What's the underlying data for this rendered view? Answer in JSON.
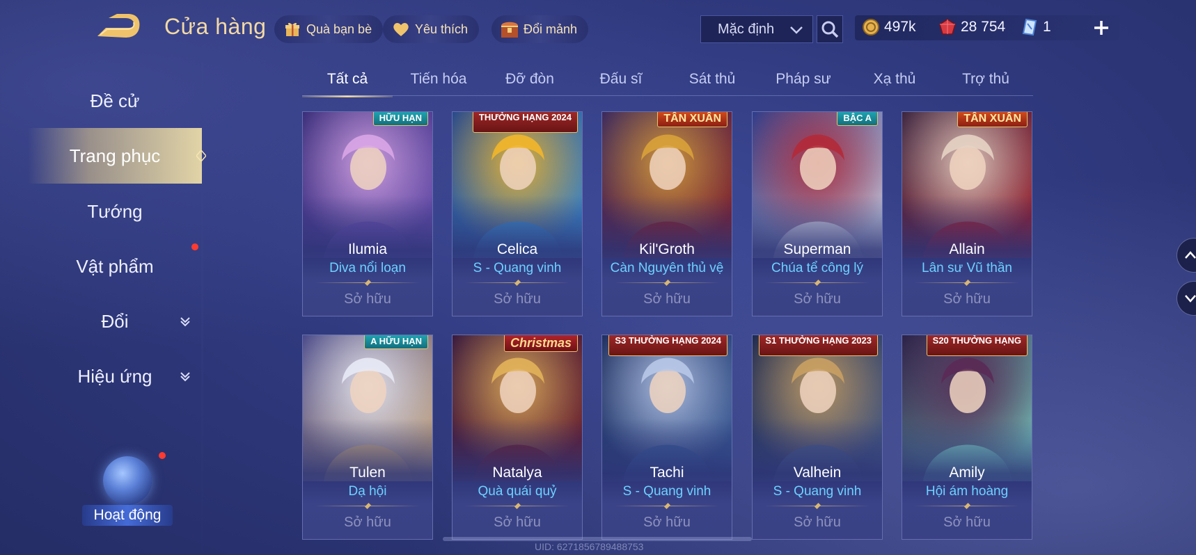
{
  "header": {
    "title": "Cửa hàng",
    "pills": [
      {
        "label": "Quà bạn bè",
        "icon": "gift-icon"
      },
      {
        "label": "Yêu thích",
        "icon": "heart-icon"
      },
      {
        "label": "Đổi mảnh",
        "icon": "chest-icon"
      }
    ],
    "sort_select": "Mặc định",
    "currencies": [
      {
        "value": "497k",
        "icon": "gold-coin-icon"
      },
      {
        "value": "28 754",
        "icon": "ruby-gem-icon"
      },
      {
        "value": "1",
        "icon": "blue-card-icon"
      }
    ]
  },
  "sidebar": {
    "items": [
      {
        "label": "Đề cử"
      },
      {
        "label": "Trang phục",
        "active": true
      },
      {
        "label": "Tướng"
      },
      {
        "label": "Vật phẩm"
      },
      {
        "label": "Đổi"
      },
      {
        "label": "Hiệu ứng"
      }
    ],
    "activity_label": "Hoạt động"
  },
  "tabs": [
    "Tất cả",
    "Tiến hóa",
    "Đỡ đòn",
    "Đấu sĩ",
    "Sát thủ",
    "Pháp sư",
    "Xạ thủ",
    "Trợ thủ"
  ],
  "active_tab": "Tất cả",
  "cards": [
    {
      "hero": "Ilumia",
      "skin": "Diva nổi loạn",
      "status": "Sở hữu",
      "badge": "HỮU HẠN",
      "badge_style": "teal",
      "colors": [
        "#6a4fb0",
        "#d9a6e6",
        "#3a2e7a"
      ]
    },
    {
      "hero": "Celica",
      "skin": "S - Quang vinh",
      "status": "Sở hữu",
      "badge": "THƯỞNG HẠNG 2024",
      "badge_style": "red",
      "colors": [
        "#3c8ed0",
        "#f2b62a",
        "#2a4a8a"
      ]
    },
    {
      "hero": "Kil'Groth",
      "skin": "Càn Nguyên thủ vệ",
      "status": "Sở hữu",
      "badge": "TÂN XUÂN",
      "badge_style": "gold",
      "colors": [
        "#8a1d24",
        "#d9a23a",
        "#3b2a5e"
      ]
    },
    {
      "hero": "Superman",
      "skin": "Chúa tể công lý",
      "status": "Sở hữu",
      "badge": "BẬC A",
      "badge_style": "teal",
      "colors": [
        "#d8d9e6",
        "#b32a38",
        "#2e3d8a"
      ]
    },
    {
      "hero": "Allain",
      "skin": "Lân sư Vũ thần",
      "status": "Sở hữu",
      "badge": "TÂN XUÂN",
      "badge_style": "gold",
      "colors": [
        "#a31d2a",
        "#e6d3c4",
        "#3b2540"
      ]
    },
    {
      "hero": "Tulen",
      "skin": "Dạ hội",
      "status": "Sở hữu",
      "badge": "A HỮU HẠN",
      "badge_style": "teal",
      "colors": [
        "#d3b07e",
        "#e8eaf6",
        "#4a4a8a"
      ]
    },
    {
      "hero": "Natalya",
      "skin": "Quà quái quỷ",
      "status": "Sở hữu",
      "badge": "Christmas",
      "badge_style": "xmas",
      "colors": [
        "#6e1c2a",
        "#e2b25a",
        "#3a1a3e"
      ]
    },
    {
      "hero": "Tachi",
      "skin": "S - Quang vinh",
      "status": "Sở hữu",
      "badge": "S3 THƯỞNG HẠNG 2024",
      "badge_style": "red",
      "colors": [
        "#3a5d9a",
        "#b8c8e8",
        "#1f2e5e"
      ]
    },
    {
      "hero": "Valhein",
      "skin": "S - Quang vinh",
      "status": "Sở hữu",
      "badge": "S1 THƯỞNG HẠNG 2023",
      "badge_style": "red",
      "colors": [
        "#4a5e88",
        "#c9a063",
        "#1f2a4e"
      ]
    },
    {
      "hero": "Amily",
      "skin": "Hội ám hoàng",
      "status": "Sở hữu",
      "badge": "S20 THƯỞNG HẠNG",
      "badge_style": "red",
      "colors": [
        "#7fd6c6",
        "#5a2a55",
        "#2c2148"
      ]
    }
  ],
  "uid_text": "UID: 6271856789488753"
}
